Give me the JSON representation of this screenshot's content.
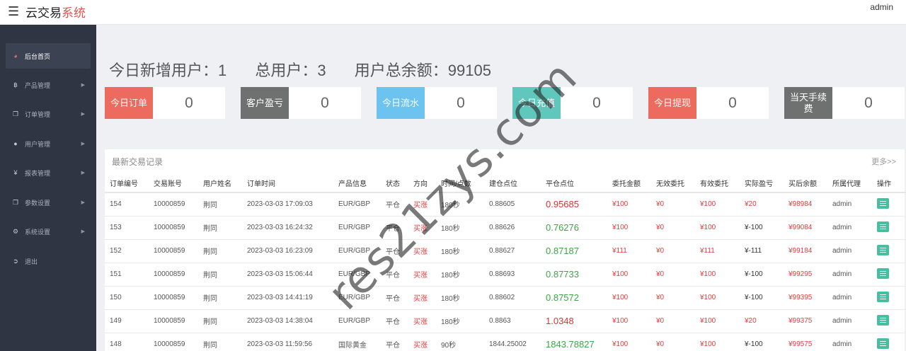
{
  "topbar": {
    "menu_icon": "hamburger-icon",
    "brand_main": "云交易",
    "brand_accent": "系统",
    "user": "admin"
  },
  "sidebar": {
    "items": [
      {
        "label": "后台首页",
        "icon": "dashboard-icon",
        "glyph": "◕",
        "active": true
      },
      {
        "label": "产品管理",
        "icon": "bitcoin-icon",
        "glyph": "฿"
      },
      {
        "label": "订单管理",
        "icon": "copy-icon",
        "glyph": "❐"
      },
      {
        "label": "用户管理",
        "icon": "user-icon",
        "glyph": "●"
      },
      {
        "label": "报表管理",
        "icon": "yen-icon",
        "glyph": "¥"
      },
      {
        "label": "参数设置",
        "icon": "copy-icon",
        "glyph": "❐"
      },
      {
        "label": "系统设置",
        "icon": "gears-icon",
        "glyph": "⚙"
      },
      {
        "label": "退出",
        "icon": "logout-icon",
        "glyph": "➲"
      }
    ]
  },
  "stats": {
    "today_new": "今日新增用户：1",
    "total_users": "总用户：3",
    "total_balance": "用户总余额：99105"
  },
  "cards": [
    {
      "label": "今日订单",
      "value": "0",
      "color": "#ec6b5e"
    },
    {
      "label": "客户盈亏",
      "value": "0",
      "color": "#6f7070"
    },
    {
      "label": "今日流水",
      "value": "0",
      "color": "#6cc3f0"
    },
    {
      "label": "今日充值",
      "value": "0",
      "color": "#5fc7bb"
    },
    {
      "label": "今日提现",
      "value": "0",
      "color": "#ec6b5e"
    },
    {
      "label": "当天手续费",
      "value": "0",
      "color": "#6f7070"
    }
  ],
  "records": {
    "title": "最新交易记录",
    "more": "更多>>",
    "columns": [
      "订单编号",
      "交易账号",
      "用户姓名",
      "订单时间",
      "产品信息",
      "状态",
      "方向",
      "时间/点数",
      "建仓点位",
      "平仓点位",
      "委托金额",
      "无效委托",
      "有效委托",
      "实际盈亏",
      "买后余额",
      "所属代理",
      "操作"
    ],
    "rows": [
      [
        "154",
        "10000859",
        "荆同",
        "2023-03-03 17:09:03",
        "EUR/GBP",
        "平仓",
        "买涨",
        "180秒",
        "0.88605",
        "0.95685",
        "¥100",
        "¥0",
        "¥100",
        "¥20",
        "¥98984",
        "admin"
      ],
      [
        "153",
        "10000859",
        "荆同",
        "2023-03-03 16:24:32",
        "EUR/GBP",
        "平仓",
        "买涨",
        "180秒",
        "0.88626",
        "0.76276",
        "¥100",
        "¥0",
        "¥100",
        "¥-100",
        "¥99084",
        "admin"
      ],
      [
        "152",
        "10000859",
        "荆同",
        "2023-03-03 16:23:09",
        "EUR/GBP",
        "平仓",
        "买涨",
        "180秒",
        "0.88627",
        "0.87187",
        "¥111",
        "¥0",
        "¥111",
        "¥-111",
        "¥99184",
        "admin"
      ],
      [
        "151",
        "10000859",
        "荆同",
        "2023-03-03 15:06:44",
        "EUR/GBP",
        "平仓",
        "买涨",
        "180秒",
        "0.88693",
        "0.87733",
        "¥100",
        "¥0",
        "¥100",
        "¥-100",
        "¥99295",
        "admin"
      ],
      [
        "150",
        "10000859",
        "荆同",
        "2023-03-03 14:41:19",
        "EUR/GBP",
        "平仓",
        "买涨",
        "180秒",
        "0.88602",
        "0.87572",
        "¥100",
        "¥0",
        "¥100",
        "¥-100",
        "¥99395",
        "admin"
      ],
      [
        "149",
        "10000859",
        "荆同",
        "2023-03-03 14:38:04",
        "EUR/GBP",
        "平仓",
        "买涨",
        "180秒",
        "0.8863",
        "1.0348",
        "¥100",
        "¥0",
        "¥100",
        "¥20",
        "¥99375",
        "admin"
      ],
      [
        "148",
        "10000859",
        "荆同",
        "2023-03-03 11:59:56",
        "国际黄金",
        "平仓",
        "买涨",
        "90秒",
        "1844.25002",
        "1843.78827",
        "¥100",
        "¥0",
        "¥100",
        "¥-100",
        "¥99575",
        "admin"
      ]
    ],
    "close_trend": [
      "up",
      "down",
      "down",
      "down",
      "down",
      "up",
      "down"
    ],
    "action_icon": "list-icon"
  },
  "watermark": "res21zys.com"
}
